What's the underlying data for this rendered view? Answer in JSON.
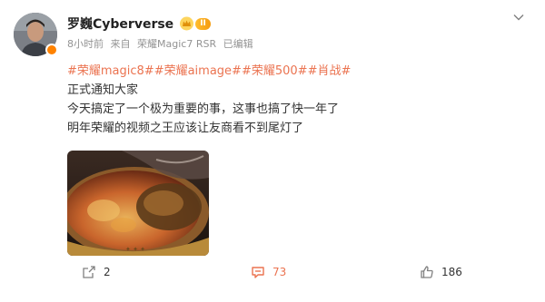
{
  "post": {
    "author": {
      "name": "罗巍Cyberverse",
      "vip_level": "II",
      "avatar_icon": "user-avatar",
      "verified_icon": "verified-badge-icon",
      "accent": "#ff8200"
    },
    "meta": {
      "time": "8小时前",
      "source_prefix": "来自",
      "source": "荣耀Magic7 RSR",
      "edited": "已编辑"
    },
    "topics": [
      "#荣耀magic8#",
      "#荣耀aimage#",
      "#荣耀500#",
      "#肖战#"
    ],
    "lines": [
      "正式通知大家",
      "今天搞定了一个极为重要的事，这事也搞了快一年了",
      "明年荣耀的视频之王应该让友商看不到尾灯了"
    ],
    "image_icon": "hotpot-photo",
    "actions": {
      "repost_count": "2",
      "comment_count": "73",
      "like_count": "186"
    },
    "colors": {
      "topic": "#eb7350",
      "meta": "#939393",
      "text": "#333333"
    }
  }
}
